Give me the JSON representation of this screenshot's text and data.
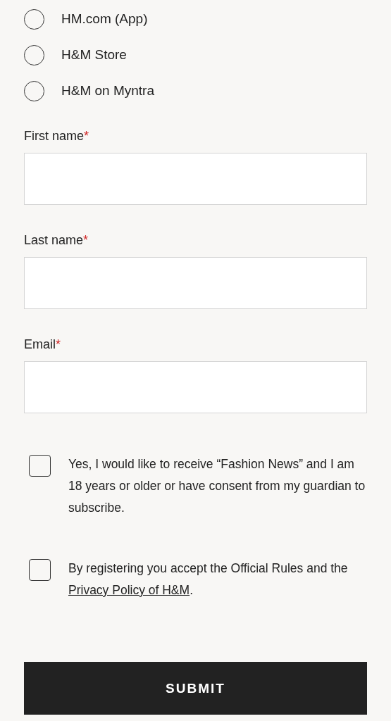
{
  "store_options": [
    {
      "label": "HM.com (App)",
      "selected": false
    },
    {
      "label": "H&M Store",
      "selected": false
    },
    {
      "label": "H&M on Myntra",
      "selected": false
    }
  ],
  "fields": [
    {
      "label": "First name",
      "required_mark": "*"
    },
    {
      "label": "Last name",
      "required_mark": "*"
    },
    {
      "label": "Email",
      "required_mark": "*"
    }
  ],
  "consents": [
    {
      "checked": false,
      "text": "Yes, I would like to receive “Fashion News” and I am 18 years or older or have consent from my guardian to subscribe."
    },
    {
      "checked": false,
      "text": "By registering you accept the Official Rules and the ",
      "link": "Privacy Policy of H&M",
      "text_after": "."
    }
  ],
  "submit_button": "SUBMIT"
}
